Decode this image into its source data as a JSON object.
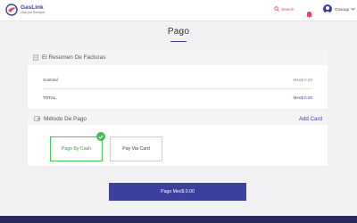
{
  "header": {
    "logo_name": "GasLink",
    "logo_tagline": "Gas por Siempre",
    "search_label": "Search",
    "bell_icon": "bell-icon",
    "user_name": "Gosoup"
  },
  "page": {
    "title": "Pago"
  },
  "summary": {
    "title": "El Resumen De Facturas",
    "icon": "receipt-icon",
    "subtotal_label": "Subtotal",
    "subtotal_value": "Mex$ 0.00",
    "total_label": "TOTAL",
    "total_value": "Mex$ 0.00"
  },
  "payment": {
    "title": "Método De Pago",
    "icon": "wallet-icon",
    "add_card_label": "Add Card",
    "options": [
      {
        "label": "Pago By Cash",
        "selected": true
      },
      {
        "label": "Pay Via Card",
        "selected": false
      }
    ]
  },
  "pay_button": {
    "label": "Pago Mex$ 0.00"
  },
  "colors": {
    "primary": "#3b3f9f",
    "accent_red": "#e2455d",
    "success": "#3ebd55",
    "footer": "#26295f",
    "background": "#f1f1f3"
  }
}
